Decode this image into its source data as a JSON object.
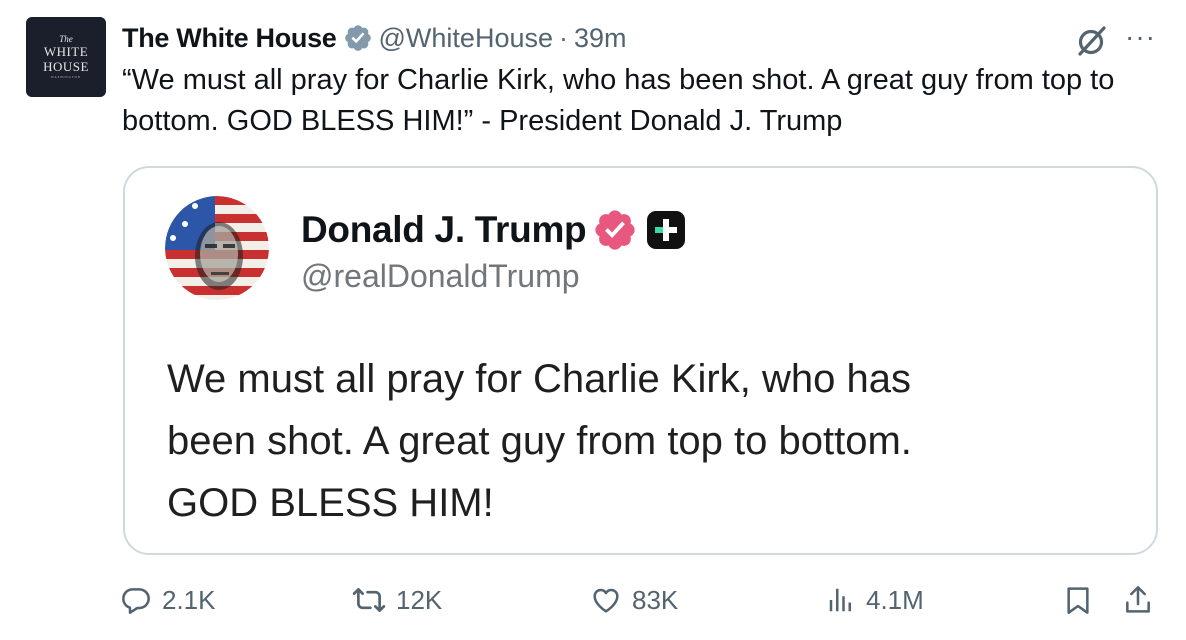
{
  "author": {
    "avatar_lines": [
      "The",
      "WHITE",
      "HOUSE",
      "WASHINGTON"
    ],
    "name": "The White House",
    "handle": "@WhiteHouse",
    "separator": "·",
    "time": "39m",
    "verified_color": "#829aab"
  },
  "tweet": {
    "text": "“We must all pray for Charlie Kirk, who has been shot. A great guy from top to bottom. GOD BLESS HIM!” - President Donald J. Trump"
  },
  "quote": {
    "name": "Donald J. Trump",
    "handle": "@realDonaldTrump",
    "verified_color": "#e8587e",
    "text_lines": [
      "We must all pray for Charlie Kirk, who has",
      "been shot. A great guy from top to bottom.",
      "GOD BLESS HIM!"
    ]
  },
  "actions": {
    "replies": "2.1K",
    "reposts": "12K",
    "likes": "83K",
    "views": "4.1M"
  },
  "icons": {
    "more": "more-icon",
    "grok": "grok-icon",
    "reply": "reply-icon",
    "repost": "repost-icon",
    "like": "heart-icon",
    "views": "views-icon",
    "bookmark": "bookmark-icon",
    "share": "share-icon"
  },
  "colors": {
    "text": "#0f1419",
    "secondary": "#536471",
    "border": "#cfd9de"
  }
}
